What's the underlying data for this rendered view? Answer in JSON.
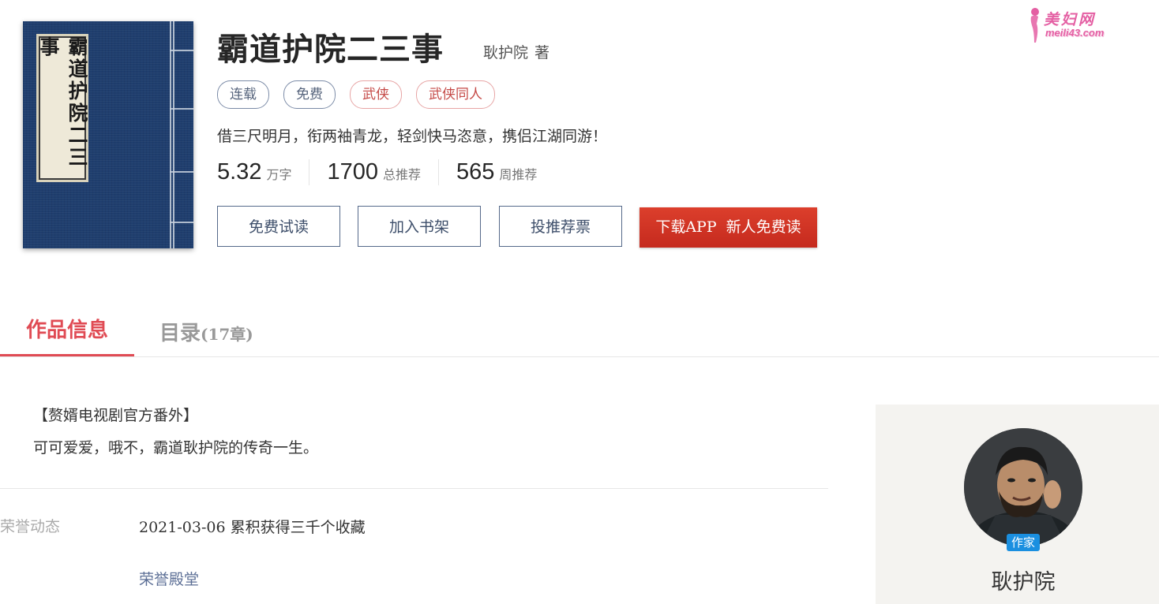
{
  "book": {
    "title": "霸道护院二三事",
    "cover_title": "霸道护院二三事",
    "author": "耿护院",
    "author_suffix": "著",
    "tags": [
      {
        "label": "连载",
        "style": "blue"
      },
      {
        "label": "免费",
        "style": "blue"
      },
      {
        "label": "武侠",
        "style": "red"
      },
      {
        "label": "武侠同人",
        "style": "red"
      }
    ],
    "intro": "借三尺明月，衔两袖青龙，轻剑快马恣意，携侣江湖同游！",
    "stats": [
      {
        "value": "5.32",
        "unit": "万字"
      },
      {
        "value": "1700",
        "unit": "总推荐"
      },
      {
        "value": "565",
        "unit": "周推荐"
      }
    ]
  },
  "actions": {
    "read_free": "免费试读",
    "add_shelf": "加入书架",
    "vote": "投推荐票",
    "download_app": "下载APP  新人免费读"
  },
  "logo": {
    "name": "美妇网",
    "url": "meili43.com"
  },
  "tabs": {
    "info": "作品信息",
    "toc": "目录",
    "toc_count": "(17章)"
  },
  "description": {
    "line1": "【赘婿电视剧官方番外】",
    "line2": "可可爱爱，哦不，霸道耿护院的传奇一生。"
  },
  "honors": {
    "label": "荣誉动态",
    "items": [
      "2021-03-06 累积获得三千个收藏"
    ],
    "hall_link": "荣誉殿堂"
  },
  "author_card": {
    "badge": "作家",
    "name": "耿护院"
  },
  "colors": {
    "accent_red": "#e04b54",
    "download_button": "#d2321f",
    "cover_blue": "#1f3e6e",
    "badge_blue": "#1a8fe0",
    "link_blue": "#5b6e95"
  }
}
